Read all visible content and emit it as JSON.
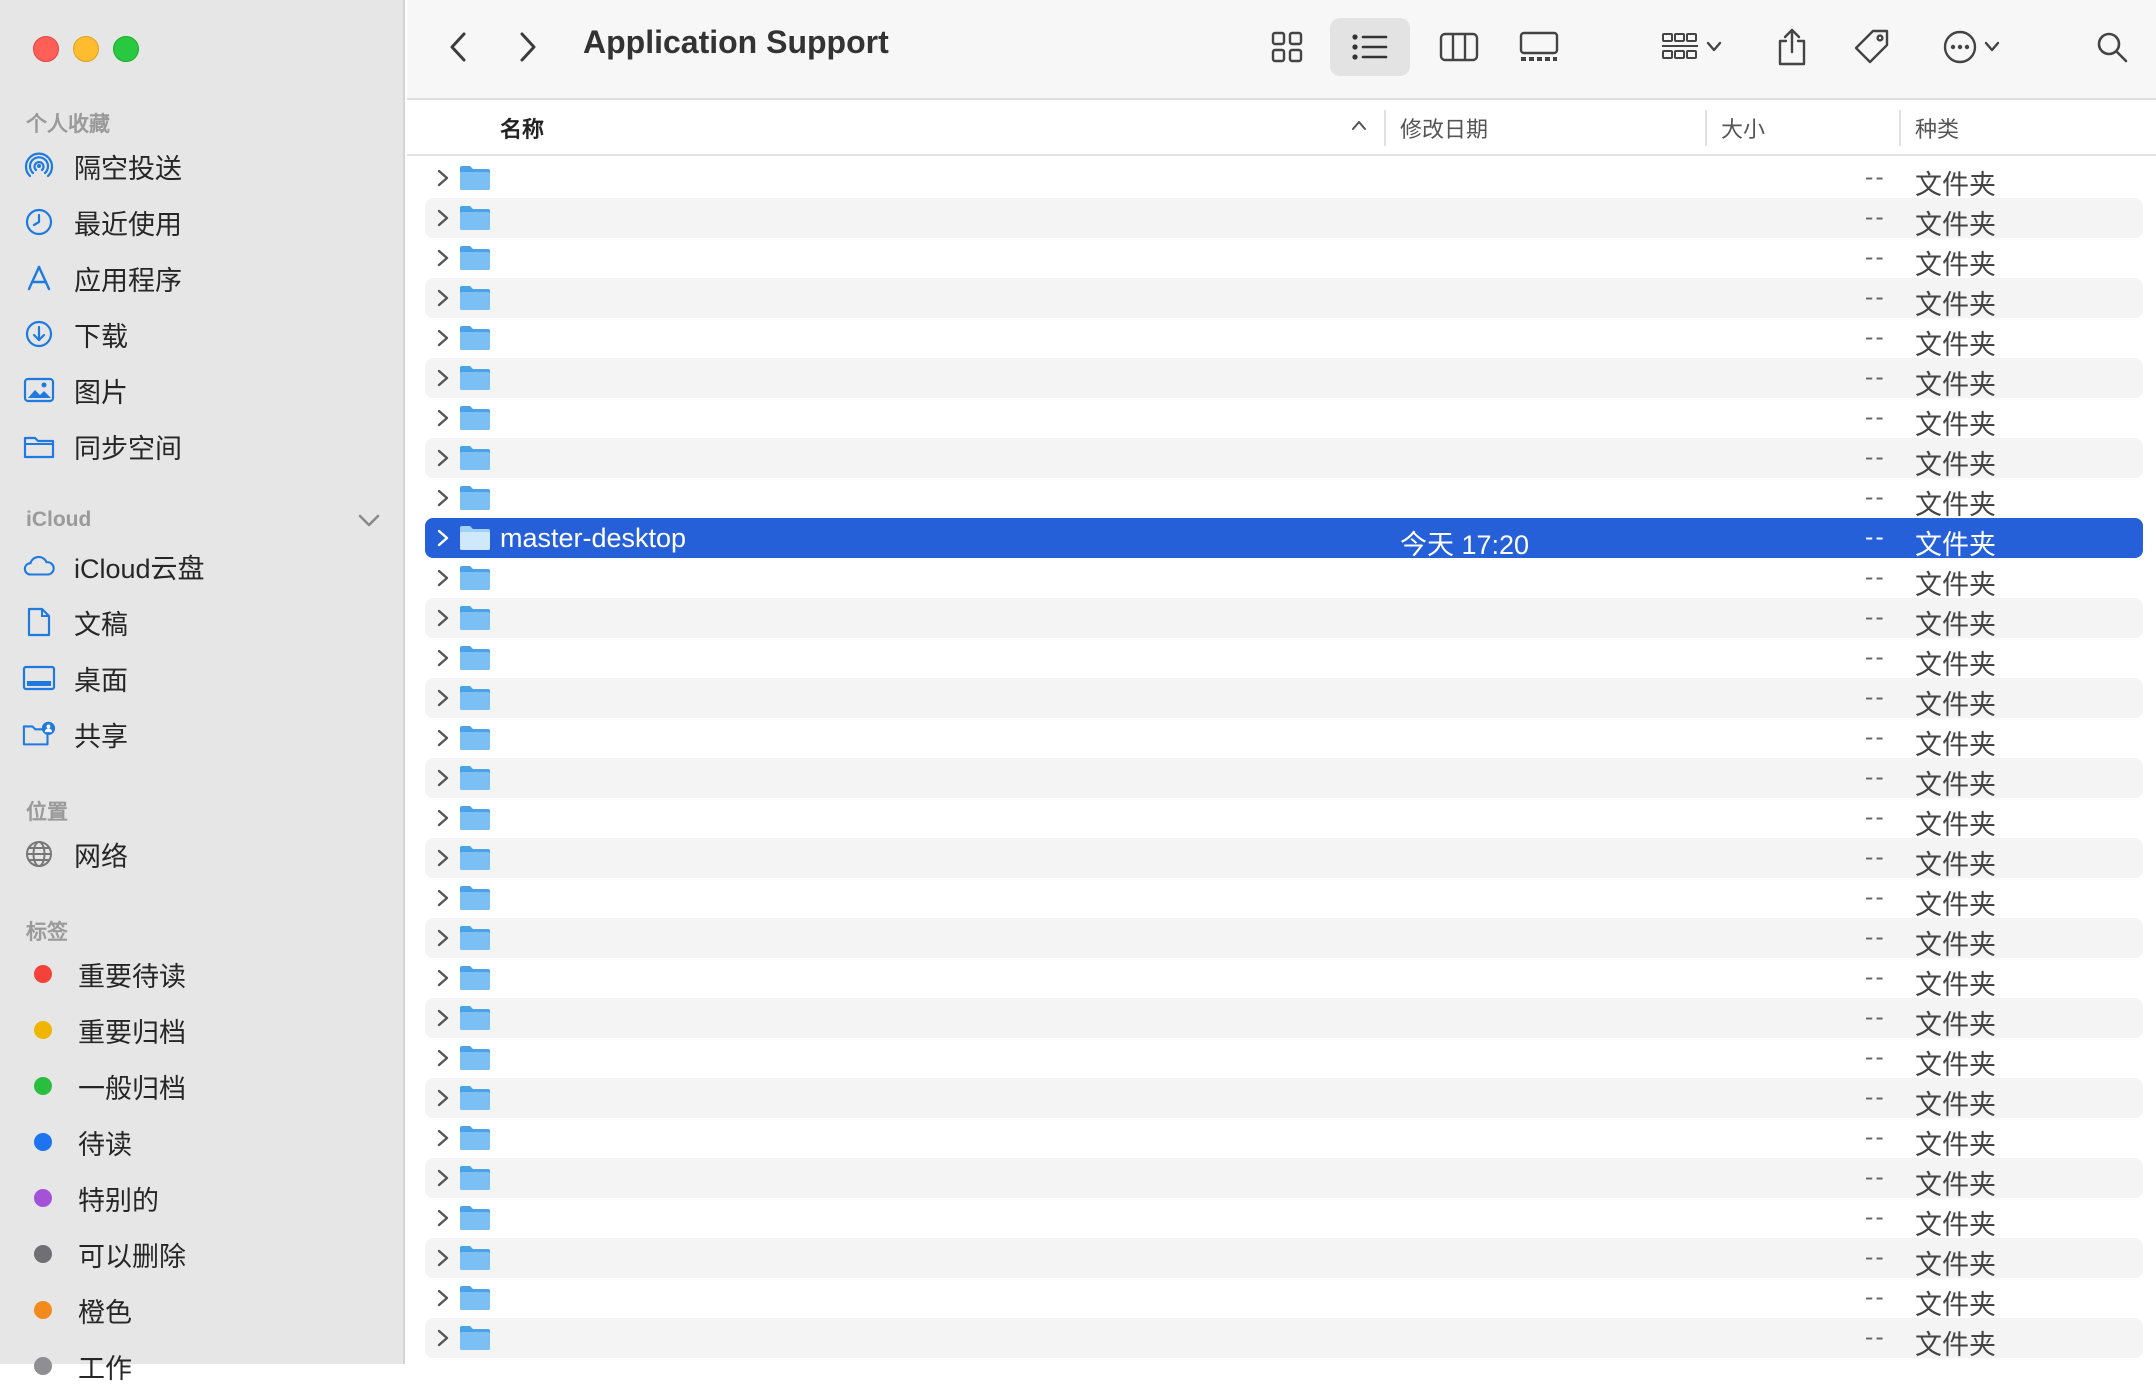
{
  "window": {
    "title": "Application Support"
  },
  "sidebar": {
    "favorites_title": "个人收藏",
    "favorites": [
      {
        "label": "隔空投送",
        "icon": "airdrop-icon"
      },
      {
        "label": "最近使用",
        "icon": "clock-icon"
      },
      {
        "label": "应用程序",
        "icon": "applications-icon"
      },
      {
        "label": "下载",
        "icon": "download-icon"
      },
      {
        "label": "图片",
        "icon": "photo-icon"
      },
      {
        "label": "同步空间",
        "icon": "folder-icon"
      }
    ],
    "icloud_title": "iCloud",
    "icloud": [
      {
        "label": "iCloud云盘",
        "icon": "cloud-icon"
      },
      {
        "label": "文稿",
        "icon": "document-icon"
      },
      {
        "label": "桌面",
        "icon": "desktop-icon"
      },
      {
        "label": "共享",
        "icon": "shared-folder-icon"
      }
    ],
    "locations_title": "位置",
    "locations": [
      {
        "label": "网络",
        "icon": "globe-icon"
      }
    ],
    "tags_title": "标签",
    "tags": [
      {
        "label": "重要待读",
        "color": "#f4413a"
      },
      {
        "label": "重要归档",
        "color": "#f0b500"
      },
      {
        "label": "一般归档",
        "color": "#2bbd3f"
      },
      {
        "label": "待读",
        "color": "#1e73f0"
      },
      {
        "label": "特别的",
        "color": "#a453d8"
      },
      {
        "label": "可以删除",
        "color": "#707074"
      },
      {
        "label": "橙色",
        "color": "#f28a1d"
      },
      {
        "label": "工作",
        "color": "#8e8e93"
      }
    ]
  },
  "columns": {
    "name": "名称",
    "date": "修改日期",
    "size": "大小",
    "kind": "种类"
  },
  "rows": [
    {
      "name": "",
      "date": "",
      "size": "--",
      "kind": "文件夹"
    },
    {
      "name": "",
      "date": "",
      "size": "--",
      "kind": "文件夹"
    },
    {
      "name": "",
      "date": "",
      "size": "--",
      "kind": "文件夹"
    },
    {
      "name": "",
      "date": "",
      "size": "--",
      "kind": "文件夹"
    },
    {
      "name": "",
      "date": "",
      "size": "--",
      "kind": "文件夹"
    },
    {
      "name": "",
      "date": "",
      "size": "--",
      "kind": "文件夹"
    },
    {
      "name": "",
      "date": "",
      "size": "--",
      "kind": "文件夹"
    },
    {
      "name": "",
      "date": "",
      "size": "--",
      "kind": "文件夹"
    },
    {
      "name": "",
      "date": "",
      "size": "--",
      "kind": "文件夹"
    },
    {
      "name": "master-desktop",
      "date": "今天 17:20",
      "size": "--",
      "kind": "文件夹",
      "selected": true
    },
    {
      "name": "",
      "date": "",
      "size": "--",
      "kind": "文件夹"
    },
    {
      "name": "",
      "date": "",
      "size": "--",
      "kind": "文件夹"
    },
    {
      "name": "",
      "date": "",
      "size": "--",
      "kind": "文件夹"
    },
    {
      "name": "",
      "date": "",
      "size": "--",
      "kind": "文件夹"
    },
    {
      "name": "",
      "date": "",
      "size": "--",
      "kind": "文件夹"
    },
    {
      "name": "",
      "date": "",
      "size": "--",
      "kind": "文件夹"
    },
    {
      "name": "",
      "date": "",
      "size": "--",
      "kind": "文件夹"
    },
    {
      "name": "",
      "date": "",
      "size": "--",
      "kind": "文件夹"
    },
    {
      "name": "",
      "date": "",
      "size": "--",
      "kind": "文件夹"
    },
    {
      "name": "",
      "date": "",
      "size": "--",
      "kind": "文件夹"
    },
    {
      "name": "",
      "date": "",
      "size": "--",
      "kind": "文件夹"
    },
    {
      "name": "",
      "date": "",
      "size": "--",
      "kind": "文件夹"
    },
    {
      "name": "",
      "date": "",
      "size": "--",
      "kind": "文件夹"
    },
    {
      "name": "",
      "date": "",
      "size": "--",
      "kind": "文件夹"
    },
    {
      "name": "",
      "date": "",
      "size": "--",
      "kind": "文件夹"
    },
    {
      "name": "",
      "date": "",
      "size": "--",
      "kind": "文件夹"
    },
    {
      "name": "",
      "date": "",
      "size": "--",
      "kind": "文件夹"
    },
    {
      "name": "",
      "date": "",
      "size": "--",
      "kind": "文件夹"
    },
    {
      "name": "",
      "date": "",
      "size": "--",
      "kind": "文件夹"
    },
    {
      "name": "",
      "date": "",
      "size": "--",
      "kind": "文件夹"
    }
  ],
  "colors": {
    "accent": "#2660d9",
    "folder": "#5eb0ee",
    "sidebar_bg": "#e6e6e6"
  }
}
